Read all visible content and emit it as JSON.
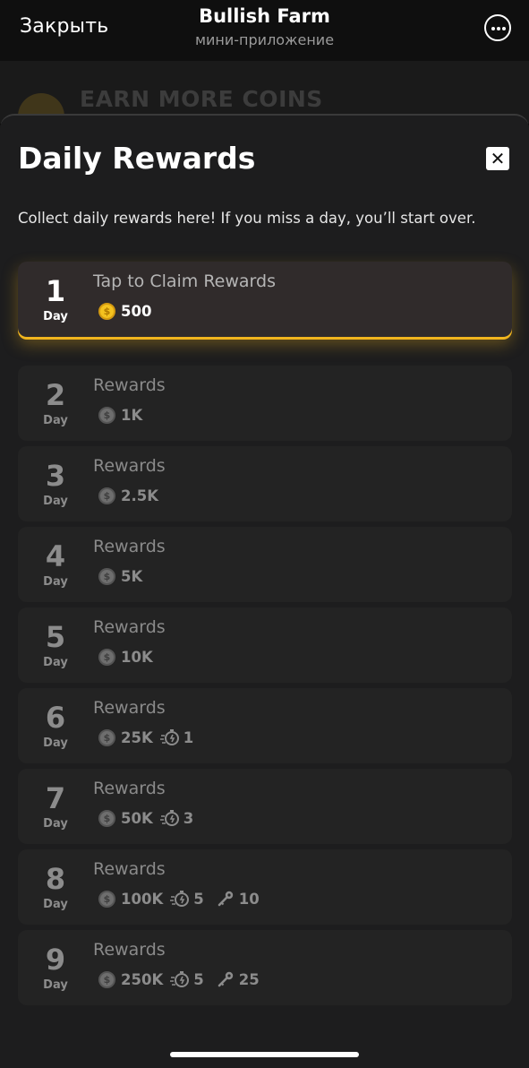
{
  "telegram": {
    "close_label": "Закрыть",
    "title": "Bullish Farm",
    "subtitle": "мини-приложение",
    "more_icon": "more-horizontal-icon"
  },
  "background": {
    "banner_text": "EARN MORE COINS"
  },
  "sheet": {
    "title": "Daily Rewards",
    "close_icon": "close-icon",
    "description": "Collect daily rewards here! If you miss a day, you’ll start over.",
    "day_label": "Day",
    "days": [
      {
        "number": "1",
        "title": "Tap to Claim Rewards",
        "coins": "500",
        "active": true
      },
      {
        "number": "2",
        "title": "Rewards",
        "coins": "1K"
      },
      {
        "number": "3",
        "title": "Rewards",
        "coins": "2.5K"
      },
      {
        "number": "4",
        "title": "Rewards",
        "coins": "5K"
      },
      {
        "number": "5",
        "title": "Rewards",
        "coins": "10K"
      },
      {
        "number": "6",
        "title": "Rewards",
        "coins": "25K",
        "boost": "1"
      },
      {
        "number": "7",
        "title": "Rewards",
        "coins": "50K",
        "boost": "3"
      },
      {
        "number": "8",
        "title": "Rewards",
        "coins": "100K",
        "boost": "5",
        "keys": "10"
      },
      {
        "number": "9",
        "title": "Rewards",
        "coins": "250K",
        "boost": "5",
        "keys": "25"
      }
    ]
  },
  "colors": {
    "accent_gold": "#f1b51e",
    "card_bg": "#232323",
    "sheet_bg": "#1d1d1e"
  }
}
